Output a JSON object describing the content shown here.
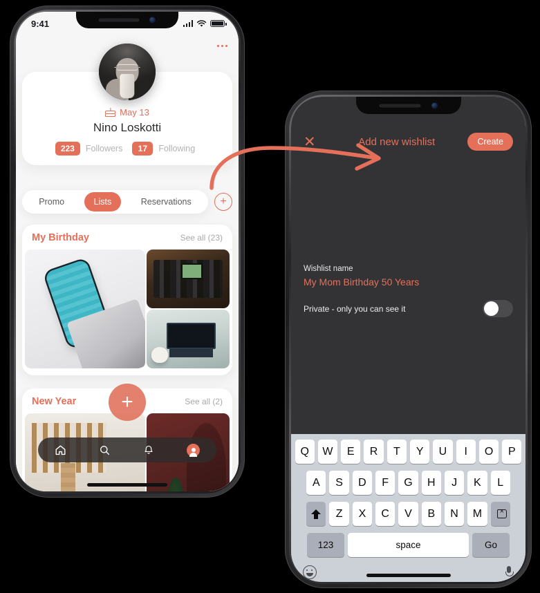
{
  "left_phone": {
    "status_bar": {
      "time": "9:41",
      "signal_icon": "cellular-bars-icon",
      "wifi_icon": "wifi-icon",
      "battery_icon": "battery-full-icon"
    },
    "profile": {
      "avatar_icon": "user-avatar-photo",
      "more_icon": "more-options-icon",
      "birthday_icon": "birthday-cake-icon",
      "birthday": "May  13",
      "name": "Nino Loskotti",
      "followers_count": "223",
      "followers_label": "Followers",
      "following_count": "17",
      "following_label": "Following"
    },
    "tabs": [
      {
        "label": "Promo",
        "active": false
      },
      {
        "label": "Lists",
        "active": true
      },
      {
        "label": "Reservations",
        "active": false
      }
    ],
    "add_tab_icon": "plus-icon",
    "cards": [
      {
        "title": "My Birthday",
        "see_all": "See all (23)"
      },
      {
        "title": "New Year",
        "see_all": "See all (2)"
      }
    ],
    "fab_icon": "plus-icon",
    "nav": [
      {
        "icon": "home-icon",
        "active": false
      },
      {
        "icon": "search-icon",
        "active": false
      },
      {
        "icon": "bell-icon",
        "active": false
      },
      {
        "icon": "profile-icon",
        "active": true
      }
    ]
  },
  "right_phone": {
    "close_icon": "close-icon",
    "title": "Add new wishlist",
    "create_label": "Create",
    "field_label": "Wishlist name",
    "field_value": "My Mom Birthday 50 Years",
    "privacy_label": "Private - only you can see it",
    "privacy_on": false,
    "keyboard": {
      "row1": [
        "Q",
        "W",
        "E",
        "R",
        "T",
        "Y",
        "U",
        "I",
        "O",
        "P"
      ],
      "row2": [
        "A",
        "S",
        "D",
        "F",
        "G",
        "H",
        "J",
        "K",
        "L"
      ],
      "row3": [
        "Z",
        "X",
        "C",
        "V",
        "B",
        "N",
        "M"
      ],
      "shift_icon": "shift-icon",
      "delete_icon": "backspace-icon",
      "numbers_label": "123",
      "space_label": "space",
      "go_label": "Go",
      "emoji_icon": "emoji-icon",
      "mic_icon": "microphone-icon"
    }
  },
  "annotation": {
    "arrow_icon": "curved-arrow-icon"
  },
  "colors": {
    "accent": "#e4705a",
    "dark_screen": "#333335",
    "light_screen": "#f6f6f6",
    "keyboard_bg": "#ccd0d7"
  }
}
